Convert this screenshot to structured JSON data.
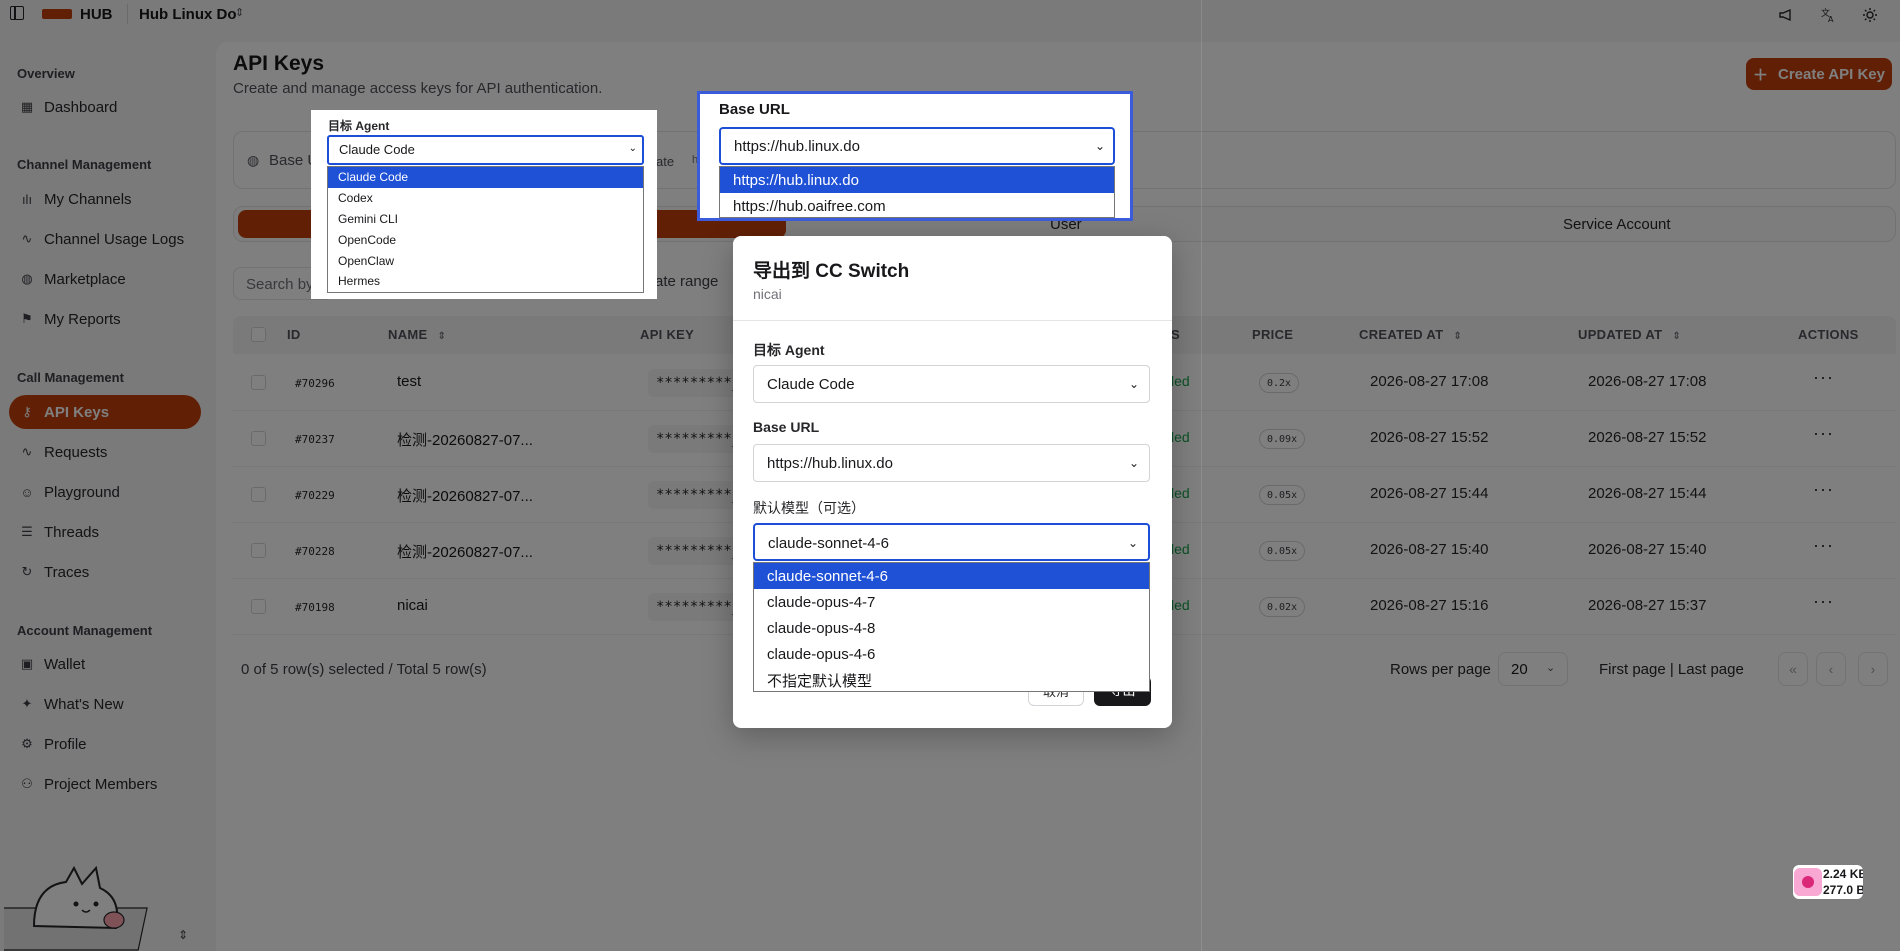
{
  "topbar": {
    "brand": "HUB",
    "project": "Hub Linux Do",
    "icons": [
      "sidebar-toggle-icon",
      "megaphone-icon",
      "translate-icon",
      "sun-icon"
    ]
  },
  "sidebar": {
    "groups": {
      "overview": "Overview",
      "channel": "Channel Management",
      "call": "Call Management",
      "account": "Account Management"
    },
    "items": [
      {
        "label": "Dashboard",
        "icon": "dashboard-icon"
      },
      {
        "label": "My Channels",
        "icon": "channels-icon"
      },
      {
        "label": "Channel Usage Logs",
        "icon": "activity-icon"
      },
      {
        "label": "Marketplace",
        "icon": "globe-icon"
      },
      {
        "label": "My Reports",
        "icon": "flag-icon"
      },
      {
        "label": "API Keys",
        "icon": "key-icon"
      },
      {
        "label": "Requests",
        "icon": "activity-icon"
      },
      {
        "label": "Playground",
        "icon": "bot-icon"
      },
      {
        "label": "Threads",
        "icon": "list-icon"
      },
      {
        "label": "Traces",
        "icon": "trace-icon"
      },
      {
        "label": "Wallet",
        "icon": "wallet-icon"
      },
      {
        "label": "What's New",
        "icon": "sparkles-icon"
      },
      {
        "label": "Profile",
        "icon": "settings-icon"
      },
      {
        "label": "Project Members",
        "icon": "users-icon"
      }
    ],
    "active_item": "API Keys"
  },
  "page": {
    "title": "API Keys",
    "subtitle": "Create and manage access keys for API authentication.",
    "create_button": "Create API Key",
    "base_url_label": "Base U",
    "base_url_frag1": "ate",
    "base_url_frag2": "h",
    "tabs": [
      "User",
      "Service Account"
    ],
    "search_placeholder": "Search by",
    "date_range": "ate range"
  },
  "table": {
    "columns": [
      "ID",
      "NAME",
      "API KEY",
      "S",
      "PRICE",
      "CREATED AT",
      "UPDATED AT",
      "ACTIONS"
    ],
    "rows": [
      {
        "id": "#70296",
        "name": "test",
        "key": "*********_",
        "status": "led",
        "price": "0.2x",
        "created": "2026-08-27 17:08",
        "updated": "2026-08-27 17:08"
      },
      {
        "id": "#70237",
        "name": "检测-20260827-07...",
        "key": "*********_",
        "status": "led",
        "price": "0.09x",
        "created": "2026-08-27 15:52",
        "updated": "2026-08-27 15:52"
      },
      {
        "id": "#70229",
        "name": "检测-20260827-07...",
        "key": "*********_",
        "status": "led",
        "price": "0.05x",
        "created": "2026-08-27 15:44",
        "updated": "2026-08-27 15:44"
      },
      {
        "id": "#70228",
        "name": "检测-20260827-07...",
        "key": "*********_",
        "status": "led",
        "price": "0.05x",
        "created": "2026-08-27 15:40",
        "updated": "2026-08-27 15:40"
      },
      {
        "id": "#70198",
        "name": "nicai",
        "key": "*********_",
        "status": "led",
        "price": "0.02x",
        "created": "2026-08-27 15:16",
        "updated": "2026-08-27 15:37"
      }
    ],
    "selection_summary": "0 of 5 row(s) selected / Total 5 row(s)",
    "rows_per_page_label": "Rows per page",
    "rows_per_page_value": "20",
    "pager_text": "First page | Last page"
  },
  "modal": {
    "title": "导出到 CC Switch",
    "subtitle": "nicai",
    "agent_label": "目标 Agent",
    "agent_value": "Claude Code",
    "base_url_label": "Base URL",
    "base_url_value": "https://hub.linux.do",
    "model_label": "默认模型（可选）",
    "model_value": "claude-sonnet-4-6",
    "model_options": [
      "claude-sonnet-4-6",
      "claude-opus-4-7",
      "claude-opus-4-8",
      "claude-opus-4-6",
      "不指定默认模型"
    ],
    "cancel_button": "取消",
    "export_button": "导出"
  },
  "agent_popup": {
    "label": "目标 Agent",
    "value": "Claude Code",
    "options": [
      "Claude Code",
      "Codex",
      "Gemini CLI",
      "OpenCode",
      "OpenClaw",
      "Hermes"
    ]
  },
  "base_popup": {
    "label": "Base URL",
    "value": "https://hub.linux.do",
    "options": [
      "https://hub.linux.do",
      "https://hub.oaifree.com"
    ]
  },
  "net_widget": {
    "up": "2.24 KB",
    "down": "277.0 B"
  },
  "colors": {
    "accent": "#c2410c",
    "select_highlight": "#1f51d6",
    "status_green": "#16a34a"
  }
}
